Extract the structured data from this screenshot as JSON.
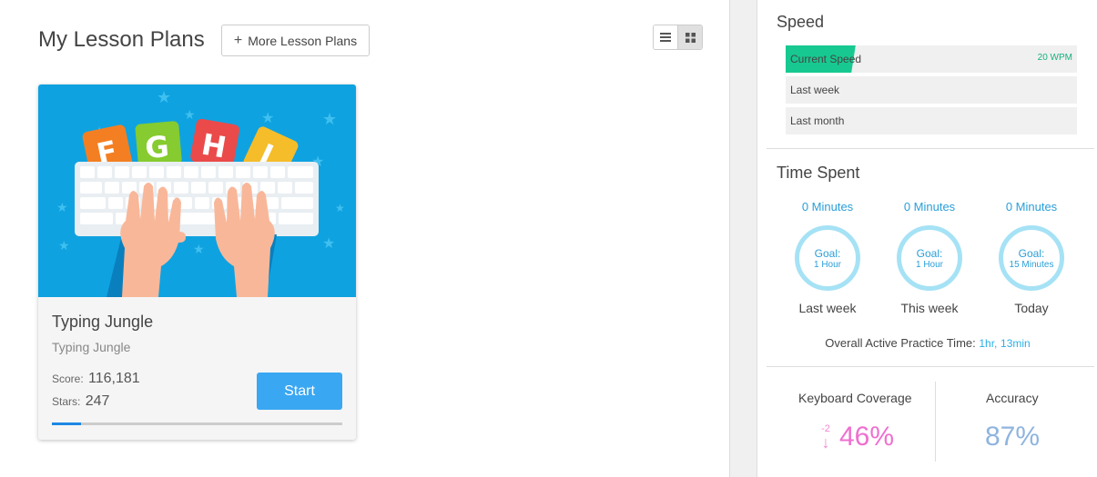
{
  "lessons": {
    "title": "My Lesson Plans",
    "more_button": "More Lesson Plans",
    "card": {
      "title": "Typing Jungle",
      "subtitle": "Typing Jungle",
      "score_label": "Score:",
      "score_value": "116,181",
      "stars_label": "Stars:",
      "stars_value": "247",
      "start_button": "Start",
      "progress": 0.1,
      "image_letters": [
        "F",
        "G",
        "H",
        "J"
      ]
    }
  },
  "speed": {
    "title": "Speed",
    "bars": [
      {
        "label": "Current Speed",
        "value": "20 WPM",
        "fill": 0.24
      },
      {
        "label": "Last week",
        "value": "",
        "fill": 0
      },
      {
        "label": "Last month",
        "value": "",
        "fill": 0
      }
    ]
  },
  "time_spent": {
    "title": "Time Spent",
    "items": [
      {
        "minutes": "0 Minutes",
        "goal_label": "Goal:",
        "goal_value": "1 Hour",
        "period": "Last week"
      },
      {
        "minutes": "0 Minutes",
        "goal_label": "Goal:",
        "goal_value": "1 Hour",
        "period": "This week"
      },
      {
        "minutes": "0 Minutes",
        "goal_label": "Goal:",
        "goal_value": "15 Minutes",
        "period": "Today"
      }
    ],
    "overall_label": "Overall Active Practice Time:",
    "overall_hours": "1hr,",
    "overall_minutes": "13min"
  },
  "stats": {
    "keyboard_coverage_label": "Keyboard Coverage",
    "keyboard_coverage_change": "-2",
    "keyboard_coverage_value": "46%",
    "accuracy_label": "Accuracy",
    "accuracy_value": "87%"
  },
  "colors": {
    "accent": "#3aa7f2",
    "speed_fill": "#17c990",
    "time_ring": "#a6e2f5",
    "coverage": "#ef6fcf",
    "accuracy": "#8fb4df"
  },
  "icons": {
    "list_view": "list-icon",
    "grid_view": "grid-icon",
    "plus": "plus-icon",
    "down_arrow": "arrow-down-icon"
  }
}
